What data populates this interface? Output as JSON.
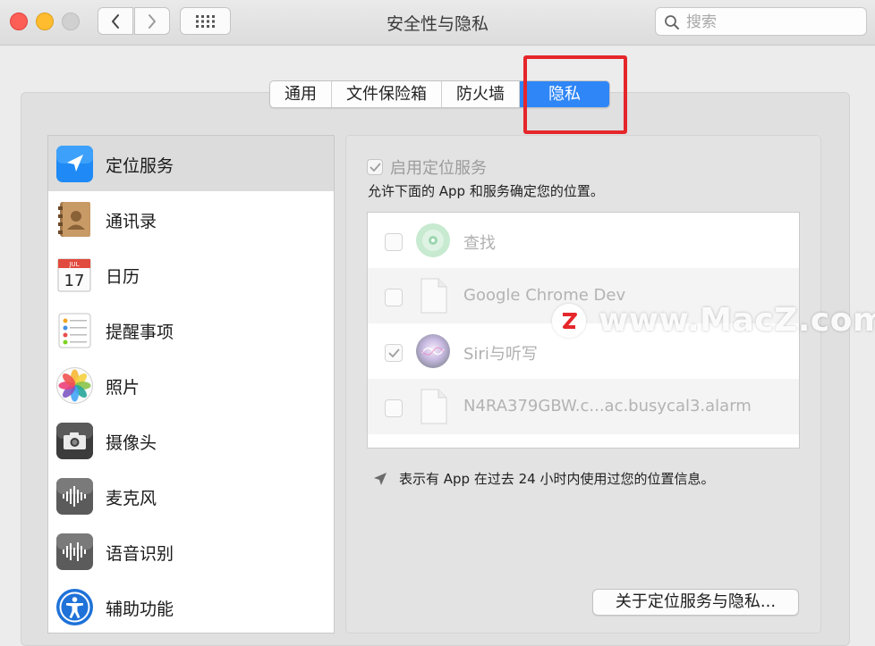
{
  "window": {
    "title": "安全性与隐私"
  },
  "search": {
    "placeholder": "搜索"
  },
  "tabs": [
    {
      "label": "通用",
      "active": false
    },
    {
      "label": "文件保险箱",
      "active": false
    },
    {
      "label": "防火墙",
      "active": false
    },
    {
      "label": "隐私",
      "active": true
    }
  ],
  "sidebar": {
    "items": [
      {
        "label": "定位服务",
        "icon": "location-arrow-icon",
        "selected": true
      },
      {
        "label": "通讯录",
        "icon": "contacts-book-icon",
        "selected": false
      },
      {
        "label": "日历",
        "icon": "calendar-icon",
        "selected": false
      },
      {
        "label": "提醒事项",
        "icon": "reminders-icon",
        "selected": false
      },
      {
        "label": "照片",
        "icon": "photos-icon",
        "selected": false
      },
      {
        "label": "摄像头",
        "icon": "camera-icon",
        "selected": false
      },
      {
        "label": "麦克风",
        "icon": "microphone-waveform-icon",
        "selected": false
      },
      {
        "label": "语音识别",
        "icon": "speech-recognition-icon",
        "selected": false
      },
      {
        "label": "辅助功能",
        "icon": "accessibility-icon",
        "selected": false
      }
    ],
    "calendar_month": "JUL",
    "calendar_day": "17"
  },
  "location": {
    "enable_label": "启用定位服务",
    "enable_checked": true,
    "allow_text": "允许下面的 App 和服务确定您的位置。",
    "apps": [
      {
        "name": "查找",
        "checked": false,
        "icon": "find-my-icon"
      },
      {
        "name": "Google Chrome Dev",
        "checked": false,
        "icon": "generic-document-icon"
      },
      {
        "name": "Siri与听写",
        "checked": true,
        "icon": "siri-icon"
      },
      {
        "name": "N4RA379GBW.c...ac.busycal3.alarm",
        "checked": false,
        "icon": "generic-document-icon"
      }
    ],
    "hint_text": "表示有 App 在过去 24 小时内使用过您的位置信息。",
    "about_button": "关于定位服务与隐私..."
  },
  "watermark": {
    "logo_letter": "Z",
    "text": "www.MacZ.com"
  },
  "colors": {
    "accent": "#2f86f6",
    "highlight": "#e5262a",
    "close": "#fd5e56",
    "minimize": "#febc2e"
  }
}
